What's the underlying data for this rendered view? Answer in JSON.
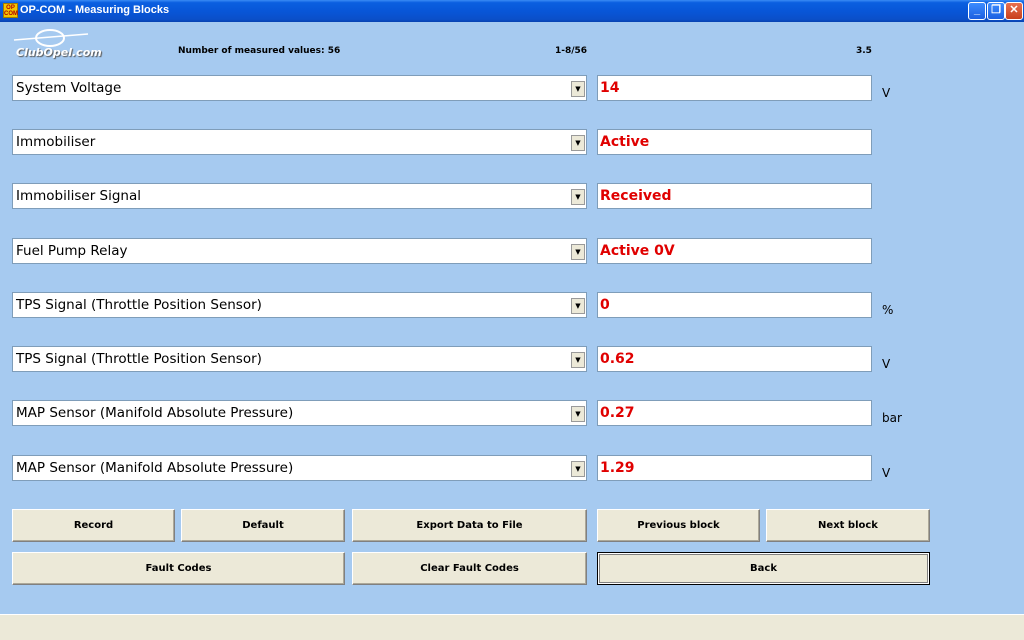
{
  "window": {
    "title": "OP-COM - Measuring Blocks",
    "icon_text": "OP COM"
  },
  "logo": {
    "text": "ClubOpel.com"
  },
  "info": {
    "measured_label": "Number of measured values: 56",
    "range": "1-8/56",
    "version": "3.5"
  },
  "rows": [
    {
      "name": "System Voltage",
      "value": "14",
      "unit": "V"
    },
    {
      "name": "Immobiliser",
      "value": "Active",
      "unit": ""
    },
    {
      "name": "Immobiliser Signal",
      "value": "Received",
      "unit": ""
    },
    {
      "name": "Fuel Pump Relay",
      "value": "Active 0V",
      "unit": ""
    },
    {
      "name": "TPS Signal (Throttle Position Sensor)",
      "value": "0",
      "unit": "%"
    },
    {
      "name": "TPS Signal (Throttle Position Sensor)",
      "value": "0.62",
      "unit": "V"
    },
    {
      "name": "MAP Sensor (Manifold Absolute Pressure)",
      "value": "0.27",
      "unit": "bar"
    },
    {
      "name": "MAP Sensor (Manifold Absolute Pressure)",
      "value": "1.29",
      "unit": "V"
    }
  ],
  "buttons": {
    "record": "Record",
    "default": "Default",
    "export": "Export Data to File",
    "previous": "Previous block",
    "next": "Next block",
    "fault_codes": "Fault Codes",
    "clear_fault_codes": "Clear Fault Codes",
    "back": "Back"
  },
  "colors": {
    "background": "#a6caf0",
    "value_text": "#e00000"
  }
}
